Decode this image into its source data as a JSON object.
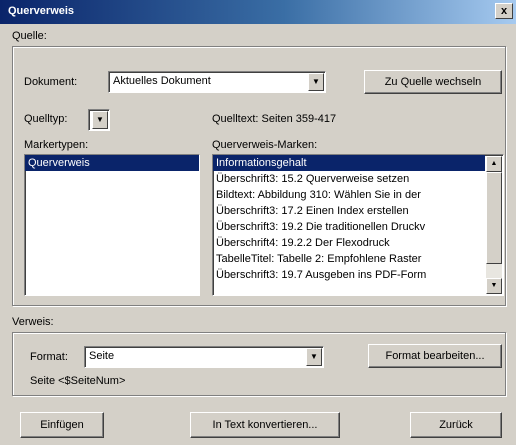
{
  "window": {
    "title": "Querverweis",
    "close_label": "x"
  },
  "source": {
    "group_label": "Quelle:",
    "document_label": "Dokument:",
    "document_value": "Aktuelles Dokument",
    "goto_source_button": "Zu Quelle wechseln",
    "source_type_label": "Quelltyp:",
    "source_text": "Quelltext: Seiten 359-417",
    "marker_types_label": "Markertypen:",
    "marker_types": [
      {
        "label": "Querverweis",
        "selected": true
      }
    ],
    "markers_label": "Querverweis-Marken:",
    "markers": [
      {
        "label": "Informationsgehalt",
        "selected": true
      },
      {
        "label": "Überschrift3: 15.2 Querverweise setzen",
        "selected": false
      },
      {
        "label": "Bildtext: Abbildung 310: Wählen Sie in der",
        "selected": false
      },
      {
        "label": "Überschrift3: 17.2 Einen Index erstellen",
        "selected": false
      },
      {
        "label": "Überschrift3: 19.2 Die traditionellen Druckv",
        "selected": false
      },
      {
        "label": "Überschrift4: 19.2.2 Der Flexodruck",
        "selected": false
      },
      {
        "label": "TabelleTitel: Tabelle 2: Empfohlene Raster",
        "selected": false
      },
      {
        "label": "Überschrift3: 19.7 Ausgeben ins PDF-Form",
        "selected": false
      }
    ]
  },
  "reference": {
    "group_label": "Verweis:",
    "format_label": "Format:",
    "format_value": "Seite",
    "edit_format_button": "Format bearbeiten...",
    "format_preview": "Seite <$SeiteNum>"
  },
  "footer": {
    "insert_button": "Einfügen",
    "convert_button": "In Text konvertieren...",
    "back_button": "Zurück"
  }
}
